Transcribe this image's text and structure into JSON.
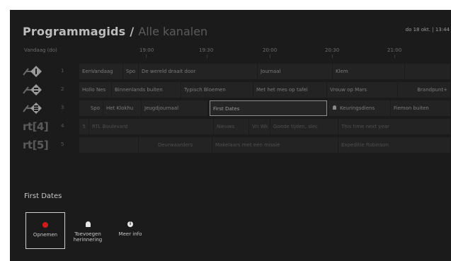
{
  "header": {
    "title": "Programmagids",
    "separator": "/",
    "subtitle": "Alle kanalen",
    "clock": "do 18 okt. | 13:44"
  },
  "timebar": {
    "today": "Vandaag (do)",
    "ticks": [
      "19:00",
      "19:30",
      "20:00",
      "20:30",
      "21:00"
    ]
  },
  "channels": [
    {
      "number": "1",
      "logo_icon": "npo1-logo-icon",
      "programs": [
        {
          "title": "EenVandaag"
        },
        {
          "title": "Spo"
        },
        {
          "title": "De wereld draait door"
        },
        {
          "title": "Journaal"
        },
        {
          "title": "Klem"
        },
        {
          "title": ""
        }
      ]
    },
    {
      "number": "2",
      "logo_icon": "npo2-logo-icon",
      "programs": [
        {
          "title": "Hollo Nes"
        },
        {
          "title": "Binnenlands buiten"
        },
        {
          "title": "Typisch Bloemen"
        },
        {
          "title": "Met het mes op tafel"
        },
        {
          "title": "Vrouw op Mars"
        },
        {
          "title": "Brandpunt+"
        }
      ]
    },
    {
      "number": "3",
      "logo_icon": "npo3-logo-icon",
      "programs": [
        {
          "title": "Spo"
        },
        {
          "title": "Het Klokhu"
        },
        {
          "title": "Jeugdjournaal"
        },
        {
          "title": "First Dates"
        },
        {
          "title": "Keuringsdiens"
        },
        {
          "title": "Fiemon buiten"
        }
      ]
    },
    {
      "number": "4",
      "logo_text": "rt[4]",
      "programs": [
        {
          "title": "5"
        },
        {
          "title": "RTL Boulevard"
        },
        {
          "title": "Nieuws"
        },
        {
          "title": "Vri Wk"
        },
        {
          "title": "Goede tijden, slec"
        },
        {
          "title": "This time next year"
        }
      ]
    },
    {
      "number": "5",
      "logo_text": "rt[5]",
      "programs": [
        {
          "title": ""
        },
        {
          "title": "Deurwaarders"
        },
        {
          "title": "Makelaars met een missie"
        },
        {
          "title": "Expeditie Robinson"
        }
      ]
    }
  ],
  "details": {
    "title": "First Dates",
    "actions": [
      {
        "label": "Opnemen",
        "icon": "record-icon"
      },
      {
        "label": "Toevoegen herinnering",
        "icon": "bell-icon"
      },
      {
        "label": "Meer info",
        "icon": "info-icon"
      }
    ]
  },
  "colors": {
    "background": "#1b1b1b",
    "cell": "#232323",
    "record": "#d21a1a"
  }
}
